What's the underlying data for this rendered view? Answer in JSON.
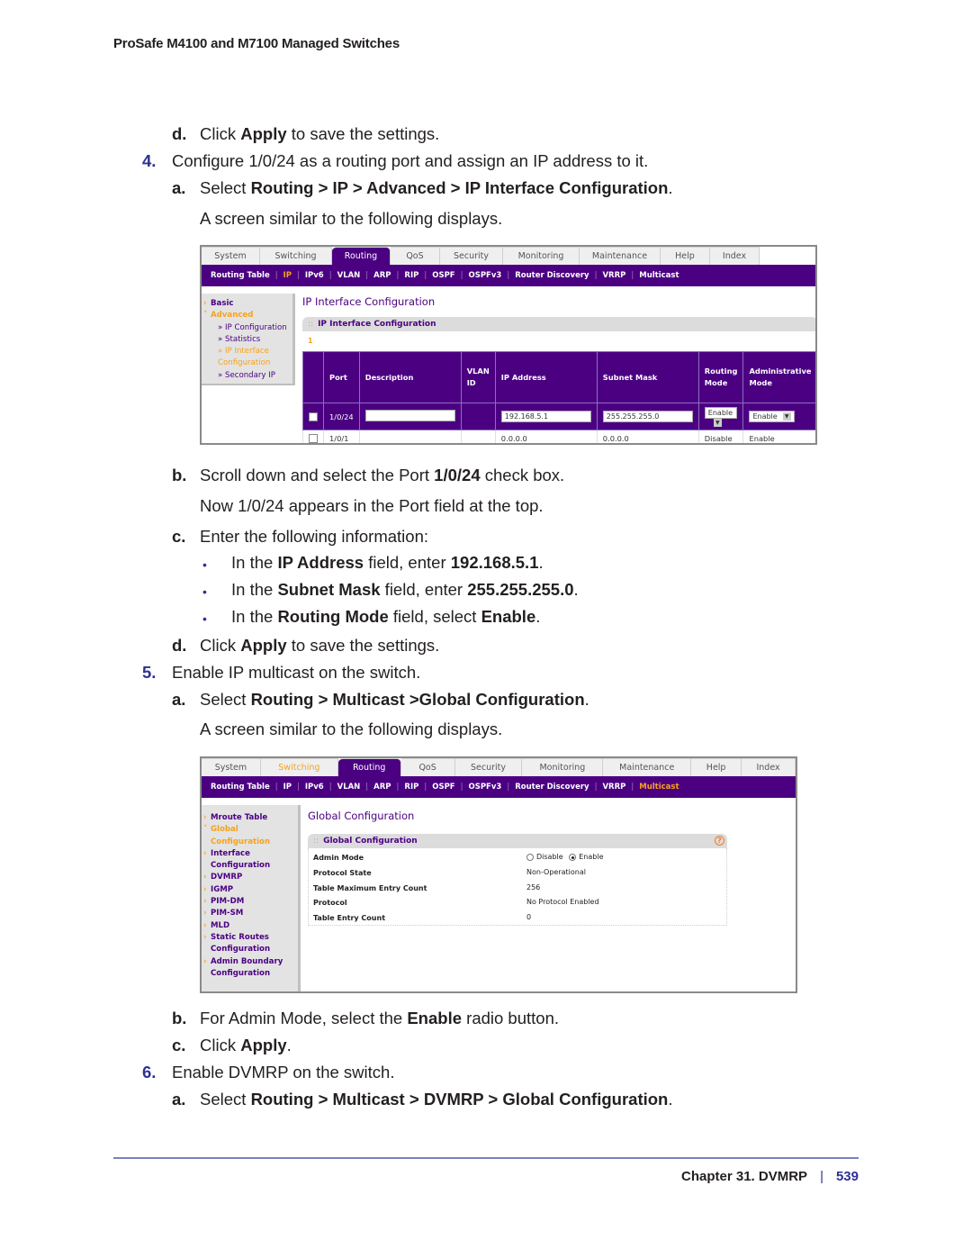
{
  "running_head": "ProSafe M4100 and M7100 Managed Switches",
  "steps": {
    "s3d": {
      "label": "d.",
      "pre": "Click ",
      "bold": "Apply",
      "post": " to save the settings."
    },
    "s4": {
      "num": "4.",
      "text": "Configure 1/0/24 as a routing port and assign an IP address to it."
    },
    "s4a": {
      "label": "a.",
      "pre": "Select ",
      "path": [
        "Routing",
        "IP",
        "Advanced",
        "IP Interface Configuration"
      ],
      "sep": " > ",
      "post": "."
    },
    "s4a_note": "A screen similar to the following displays.",
    "s4b": {
      "label": "b.",
      "pre": "Scroll down and select the Port ",
      "bold": "1/0/24",
      "post": " check box."
    },
    "s4b_note": "Now 1/0/24 appears in the Port field at the top.",
    "s4c": {
      "label": "c.",
      "text": "Enter the following information:"
    },
    "bullets": [
      {
        "pre": "In the ",
        "field": "IP Address",
        "mid": " field, enter ",
        "value": "192.168.5.1",
        "post": "."
      },
      {
        "pre": "In the ",
        "field": "Subnet Mask",
        "mid": " field, enter ",
        "value": "255.255.255.0",
        "post": "."
      },
      {
        "pre": "In the ",
        "field": "Routing Mode",
        "mid": " field, select ",
        "value": "Enable",
        "post": "."
      }
    ],
    "s4d": {
      "label": "d.",
      "pre": "Click ",
      "bold": "Apply",
      "post": " to save the settings."
    },
    "s5": {
      "num": "5.",
      "text": "Enable IP multicast on the switch."
    },
    "s5a": {
      "label": "a.",
      "pre": "Select ",
      "bold1": "Routing",
      "sep1": " > ",
      "bold2": "Multicast",
      "sep2": " >",
      "bold3": "Global Configuration",
      "post": "."
    },
    "s5a_note": "A screen similar to the following displays.",
    "s5b": {
      "label": "b.",
      "pre": "For Admin Mode, select the ",
      "bold": "Enable",
      "post": " radio button."
    },
    "s5c": {
      "label": "c.",
      "pre": "Click ",
      "bold": "Apply",
      "post": "."
    },
    "s6": {
      "num": "6.",
      "text": "Enable DVMRP on the switch."
    },
    "s6a": {
      "label": "a.",
      "pre": "Select ",
      "path": [
        "Routing",
        "Multicast",
        "DVMRP",
        "Global Configuration"
      ],
      "sep": " > ",
      "post": "."
    }
  },
  "shot1": {
    "tabs": [
      "System",
      "Switching",
      "Routing",
      "QoS",
      "Security",
      "Monitoring",
      "Maintenance",
      "Help",
      "Index"
    ],
    "active_tab": "Routing",
    "subnav": [
      "Routing Table",
      "IP",
      "IPv6",
      "VLAN",
      "ARP",
      "RIP",
      "OSPF",
      "OSPFv3",
      "Router Discovery",
      "VRRP",
      "Multicast"
    ],
    "subnav_selected": "IP",
    "sidebar": [
      {
        "label": "Basic",
        "type": "top"
      },
      {
        "label": "Advanced",
        "type": "top-current"
      },
      {
        "label": "» IP Configuration",
        "type": "sub"
      },
      {
        "label": "» Statistics",
        "type": "sub"
      },
      {
        "label": "» IP Interface",
        "type": "sub-current"
      },
      {
        "label": "Configuration",
        "type": "sub-current-cont"
      },
      {
        "label": "» Secondary IP",
        "type": "sub"
      }
    ],
    "page_title": "IP Interface Configuration",
    "panel_title": "IP Interface Configuration",
    "marker": "1",
    "columns": [
      "Port",
      "Description",
      "VLAN ID",
      "IP Address",
      "Subnet Mask",
      "Routing Mode",
      "Administrative Mode"
    ],
    "edit_row": {
      "port": "1/0/24",
      "description": "",
      "vlan_id": "",
      "ip": "192.168.5.1",
      "mask": "255.255.255.0",
      "routing_mode": "Enable",
      "admin_mode": "Enable"
    },
    "rows": [
      {
        "port": "1/0/1",
        "description": "",
        "vlan_id": "",
        "ip": "0.0.0.0",
        "mask": "0.0.0.0",
        "routing_mode": "Disable",
        "admin_mode": "Enable"
      }
    ]
  },
  "shot2": {
    "tabs": [
      "System",
      "Switching",
      "Routing",
      "QoS",
      "Security",
      "Monitoring",
      "Maintenance",
      "Help",
      "Index"
    ],
    "active_tab": "Routing",
    "highlight_tab": "Switching",
    "subnav": [
      "Routing Table",
      "IP",
      "IPv6",
      "VLAN",
      "ARP",
      "RIP",
      "OSPF",
      "OSPFv3",
      "Router Discovery",
      "VRRP",
      "Multicast"
    ],
    "subnav_selected": "Multicast",
    "sidebar": [
      {
        "label": "Mroute Table",
        "type": "top"
      },
      {
        "label": "Global",
        "type": "top-current"
      },
      {
        "label": "Configuration",
        "type": "cont-current"
      },
      {
        "label": "Interface",
        "type": "top"
      },
      {
        "label": "Configuration",
        "type": "cont"
      },
      {
        "label": "DVMRP",
        "type": "top"
      },
      {
        "label": "IGMP",
        "type": "top"
      },
      {
        "label": "PIM-DM",
        "type": "top"
      },
      {
        "label": "PIM-SM",
        "type": "top"
      },
      {
        "label": "MLD",
        "type": "top"
      },
      {
        "label": "Static Routes",
        "type": "top"
      },
      {
        "label": "Configuration",
        "type": "cont"
      },
      {
        "label": "Admin Boundary",
        "type": "top"
      },
      {
        "label": "Configuration",
        "type": "cont"
      }
    ],
    "page_title": "Global Configuration",
    "panel_title": "Global Configuration",
    "help_icon": "?",
    "fields": [
      {
        "label": "Admin Mode",
        "value": "",
        "radio": [
          "Disable",
          "Enable"
        ],
        "selected": "Enable"
      },
      {
        "label": "Protocol State",
        "value": "Non-Operational"
      },
      {
        "label": "Table Maximum Entry Count",
        "value": "256"
      },
      {
        "label": "Protocol",
        "value": "No Protocol Enabled"
      },
      {
        "label": "Table Entry Count",
        "value": "0"
      }
    ]
  },
  "footer": {
    "chapter": "Chapter 31.  DVMRP",
    "page": "539"
  }
}
